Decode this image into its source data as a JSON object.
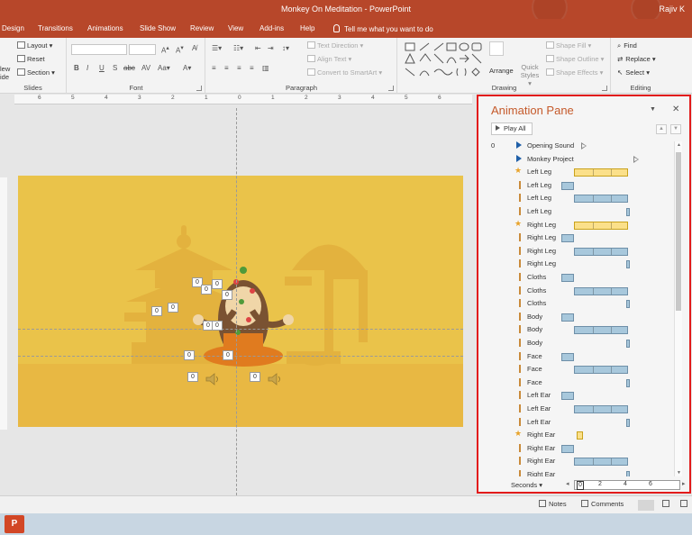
{
  "window": {
    "title": "Monkey On Meditation - PowerPoint",
    "user": "Rajiv K"
  },
  "tabs": [
    "Design",
    "Transitions",
    "Animations",
    "Slide Show",
    "Review",
    "View",
    "Add-ins",
    "Help"
  ],
  "tell_me": "Tell me what you want to do",
  "ribbon": {
    "slides": {
      "label": "Slides",
      "new_slide_partial": "lew",
      "new_slide_partial2": "ide",
      "layout": "Layout",
      "reset": "Reset",
      "section": "Section"
    },
    "font": {
      "label": "Font"
    },
    "paragraph": {
      "label": "Paragraph",
      "text_direction": "Text Direction",
      "align_text": "Align Text",
      "convert_smartart": "Convert to SmartArt"
    },
    "drawing": {
      "label": "Drawing",
      "arrange": "Arrange",
      "quick_styles": "Quick Styles",
      "shape_fill": "Shape Fill",
      "shape_outline": "Shape Outline",
      "shape_effects": "Shape Effects"
    },
    "editing": {
      "label": "Editing",
      "find": "Find",
      "replace": "Replace",
      "select": "Select"
    }
  },
  "ruler": [
    "6",
    "5",
    "4",
    "3",
    "2",
    "1",
    "0",
    "1",
    "2",
    "3",
    "4",
    "5",
    "6"
  ],
  "slide": {
    "background_color": "#eac34a",
    "tags": [
      "0",
      "0",
      "0",
      "0",
      "0",
      "0",
      "0",
      "0",
      "0",
      "0",
      "0",
      "0"
    ]
  },
  "animation_pane": {
    "title": "Animation Pane",
    "play_all": "Play All",
    "items": [
      {
        "index": "0",
        "name": "Opening Sound",
        "icon": "play-icon"
      },
      {
        "index": "",
        "name": "Monkey Project",
        "icon": "play-icon"
      },
      {
        "index": "",
        "name": "Left Leg",
        "icon": "star-icon"
      },
      {
        "index": "",
        "name": "Left Leg",
        "icon": "clock-icon"
      },
      {
        "index": "",
        "name": "Left Leg",
        "icon": "clock-icon"
      },
      {
        "index": "",
        "name": "Left Leg",
        "icon": "clock-icon"
      },
      {
        "index": "",
        "name": "Right Leg",
        "icon": "star-icon"
      },
      {
        "index": "",
        "name": "Right Leg",
        "icon": "clock-icon"
      },
      {
        "index": "",
        "name": "Right Leg",
        "icon": "clock-icon"
      },
      {
        "index": "",
        "name": "Right Leg",
        "icon": "clock-icon"
      },
      {
        "index": "",
        "name": "Cloths",
        "icon": "clock-icon"
      },
      {
        "index": "",
        "name": "Cloths",
        "icon": "clock-icon"
      },
      {
        "index": "",
        "name": "Cloths",
        "icon": "clock-icon"
      },
      {
        "index": "",
        "name": "Body",
        "icon": "clock-icon"
      },
      {
        "index": "",
        "name": "Body",
        "icon": "clock-icon"
      },
      {
        "index": "",
        "name": "Body",
        "icon": "clock-icon"
      },
      {
        "index": "",
        "name": "Face",
        "icon": "clock-icon"
      },
      {
        "index": "",
        "name": "Face",
        "icon": "clock-icon"
      },
      {
        "index": "",
        "name": "Face",
        "icon": "clock-icon"
      },
      {
        "index": "",
        "name": "Left Ear",
        "icon": "clock-icon"
      },
      {
        "index": "",
        "name": "Left Ear",
        "icon": "clock-icon"
      },
      {
        "index": "",
        "name": "Left Ear",
        "icon": "clock-icon"
      },
      {
        "index": "",
        "name": "Right Ear",
        "icon": "star-icon"
      },
      {
        "index": "",
        "name": "Right Ear",
        "icon": "clock-icon"
      },
      {
        "index": "",
        "name": "Right Ear",
        "icon": "clock-icon"
      },
      {
        "index": "",
        "name": "Right Ear",
        "icon": "clock-icon"
      }
    ],
    "seconds_label": "Seconds",
    "timeline": [
      "0",
      "2",
      "4",
      "6"
    ]
  },
  "status_bar": {
    "notes": "Notes",
    "comments": "Comments"
  },
  "taskbar": {
    "app_letter": "P"
  }
}
